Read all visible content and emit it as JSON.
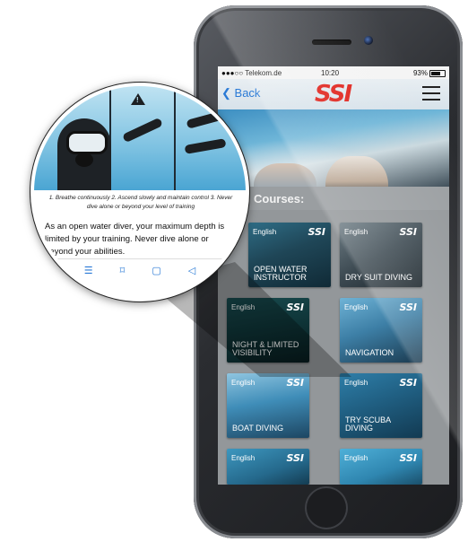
{
  "status_bar": {
    "carrier": "●●●○○ Telekom.de ",
    "time": "10:20",
    "battery": "93%"
  },
  "nav": {
    "back_label": "Back",
    "logo_text": "SSI",
    "menu_icon": "hamburger-icon"
  },
  "section": {
    "title": "Courses:"
  },
  "courses": [
    {
      "lang": "English",
      "title": "OPEN WATER INSTRUCTOR",
      "badge": "SSI"
    },
    {
      "lang": "English",
      "title": "DRY SUIT DIVING",
      "badge": "SSI"
    },
    {
      "lang": "English",
      "title": "NIGHT & LIMITED VISIBILITY",
      "badge": "SSI"
    },
    {
      "lang": "English",
      "title": "NAVIGATION",
      "badge": "SSI"
    },
    {
      "lang": "English",
      "title": "BOAT DIVING",
      "badge": "SSI"
    },
    {
      "lang": "English",
      "title": "TRY SCUBA DIVING",
      "badge": "SSI"
    },
    {
      "lang": "English",
      "title": "",
      "badge": "SSI"
    },
    {
      "lang": "English",
      "title": "",
      "badge": "SSI"
    }
  ],
  "magnifier": {
    "caption": "1. Breathe continuously 2. Ascend slowly and maintain control 3. Never dive alone or beyond your level of training",
    "body": "As an open water diver, your maximum depth is limited by your training. Never dive alone or beyond your abilities.",
    "warning_icon": "warning-icon",
    "toolbar_icons": [
      "list-icon",
      "bookmark-icon",
      "page-icon",
      "share-icon"
    ],
    "toolbar_glyphs": [
      "☰",
      "⌑",
      "▢",
      "◁"
    ]
  },
  "colors": {
    "accent": "#2a7ad6",
    "logo_red": "#e0221b",
    "section_bg": "#9a9ea1"
  }
}
